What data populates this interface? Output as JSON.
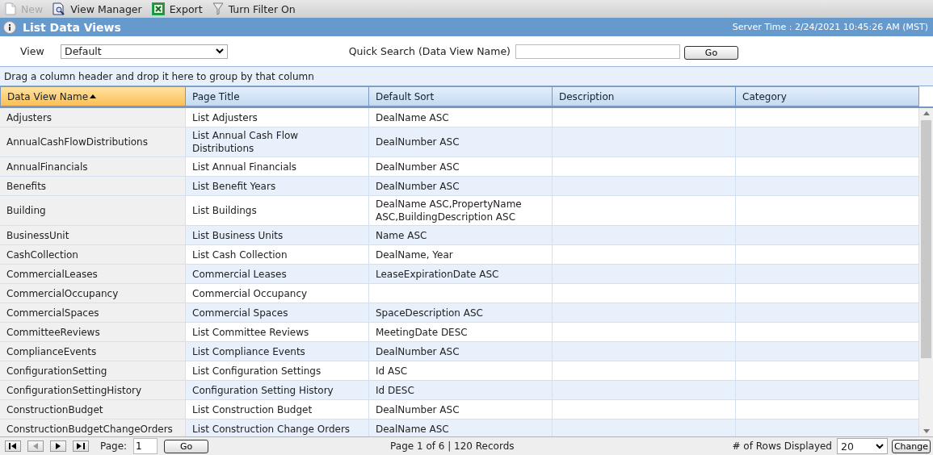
{
  "toolbar": [
    {
      "label": "New",
      "kind": "new",
      "disabled": true
    },
    {
      "label": "View Manager",
      "kind": "manager",
      "disabled": false
    },
    {
      "label": "Export",
      "kind": "excel",
      "disabled": false
    },
    {
      "label": "Turn Filter On",
      "kind": "filter",
      "disabled": false
    }
  ],
  "title_bar": {
    "title": "List Data Views",
    "server_time": "Server Time : 2/24/2021 10:45:26 AM (MST)"
  },
  "filter": {
    "view_label": "View",
    "view_value": "Default",
    "search_label": "Quick Search (Data View Name)",
    "go": "Go"
  },
  "group_panel": "Drag a column header and drop it here to group by that column",
  "table": {
    "columns": [
      {
        "label": "Data View Name",
        "sorted": true
      },
      {
        "label": "Page Title",
        "sorted": false
      },
      {
        "label": "Default Sort",
        "sorted": false
      },
      {
        "label": "Description",
        "sorted": false
      },
      {
        "label": "Category",
        "sorted": false
      }
    ],
    "rows": [
      [
        "Adjusters",
        "List Adjusters",
        "DealName ASC",
        "",
        ""
      ],
      [
        "AnnualCashFlowDistributions",
        "List Annual Cash Flow Distributions",
        "DealNumber ASC",
        "",
        ""
      ],
      [
        "AnnualFinancials",
        "List Annual Financials",
        "DealNumber ASC",
        "",
        ""
      ],
      [
        "Benefits",
        "List Benefit Years",
        "DealNumber ASC",
        "",
        ""
      ],
      [
        "Building",
        "List Buildings",
        "DealName ASC,PropertyName ASC,BuildingDescription ASC",
        "",
        ""
      ],
      [
        "BusinessUnit",
        "List Business Units",
        "Name ASC",
        "",
        ""
      ],
      [
        "CashCollection",
        "List Cash Collection",
        "DealName, Year",
        "",
        ""
      ],
      [
        "CommercialLeases",
        "Commercial Leases",
        "LeaseExpirationDate ASC",
        "",
        ""
      ],
      [
        "CommercialOccupancy",
        "Commercial Occupancy",
        "",
        "",
        ""
      ],
      [
        "CommercialSpaces",
        "Commercial Spaces",
        "SpaceDescription ASC",
        "",
        ""
      ],
      [
        "CommitteeReviews",
        "List Committee Reviews",
        "MeetingDate DESC",
        "",
        ""
      ],
      [
        "ComplianceEvents",
        "List Compliance Events",
        "DealNumber ASC",
        "",
        ""
      ],
      [
        "ConfigurationSetting",
        "List Configuration Settings",
        "Id ASC",
        "",
        ""
      ],
      [
        "ConfigurationSettingHistory",
        "Configuration Setting History",
        "Id DESC",
        "",
        ""
      ],
      [
        "ConstructionBudget",
        "List Construction Budget",
        "DealNumber ASC",
        "",
        ""
      ],
      [
        "ConstructionBudgetChangeOrders",
        "List Construction Change Orders",
        "DealName ASC",
        "",
        ""
      ]
    ]
  },
  "pager": {
    "page_label": "Page:",
    "page_value": "1",
    "go": "Go",
    "summary": "Page 1 of 6 | 120 Records",
    "rows_label": "# of Rows Displayed",
    "rows_value": "20",
    "change": "Change"
  }
}
